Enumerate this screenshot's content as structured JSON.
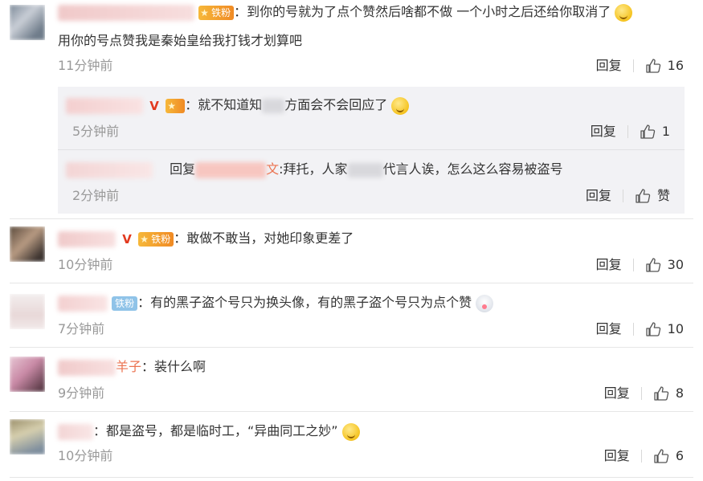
{
  "colors": {
    "time": "#999999",
    "link": "#eb7350",
    "fan_badge": "#f08a24",
    "fan_badge_blue": "#8fc3e8",
    "sub_bg": "#f2f2f5"
  },
  "comments": [
    {
      "badge": "铁粉",
      "text_line1": "：到你的号就为了点个赞然后啥都不做 一个小时之后还给你取消了",
      "text_line2": "用你的号点赞我是秦始皇给我打钱才划算吧",
      "time": "11分钟前",
      "reply": "回复",
      "likes": "16"
    },
    {
      "badge": "铁粉",
      "text": "：敢做不敢当，对她印象更差了",
      "time": "10分钟前",
      "reply": "回复",
      "likes": "30"
    },
    {
      "badge": "铁粉",
      "text": "：有的黑子盗个号只为换头像，有的黑子盗个号只为点个赞",
      "time": "7分钟前",
      "reply": "回复",
      "likes": "10"
    },
    {
      "name_tail": "羊子",
      "text": "：装什么啊",
      "time": "9分钟前",
      "reply": "回复",
      "likes": "8"
    },
    {
      "text": "：都是盗号，都是临时工，“异曲同工之妙”",
      "time": "10分钟前",
      "reply": "回复",
      "likes": "6"
    }
  ],
  "sub_replies": [
    {
      "text_a": "：就不知道知",
      "text_b": "方面会不会回应了",
      "time": "5分钟前",
      "reply": "回复",
      "likes": "1"
    },
    {
      "reply_prefix": "回复",
      "at_tail": "文",
      "text_a": ":拜托，人家",
      "text_b": "代言人诶，怎么这么容易被盗号",
      "time": "2分钟前",
      "reply": "回复",
      "likes": "赞"
    }
  ]
}
